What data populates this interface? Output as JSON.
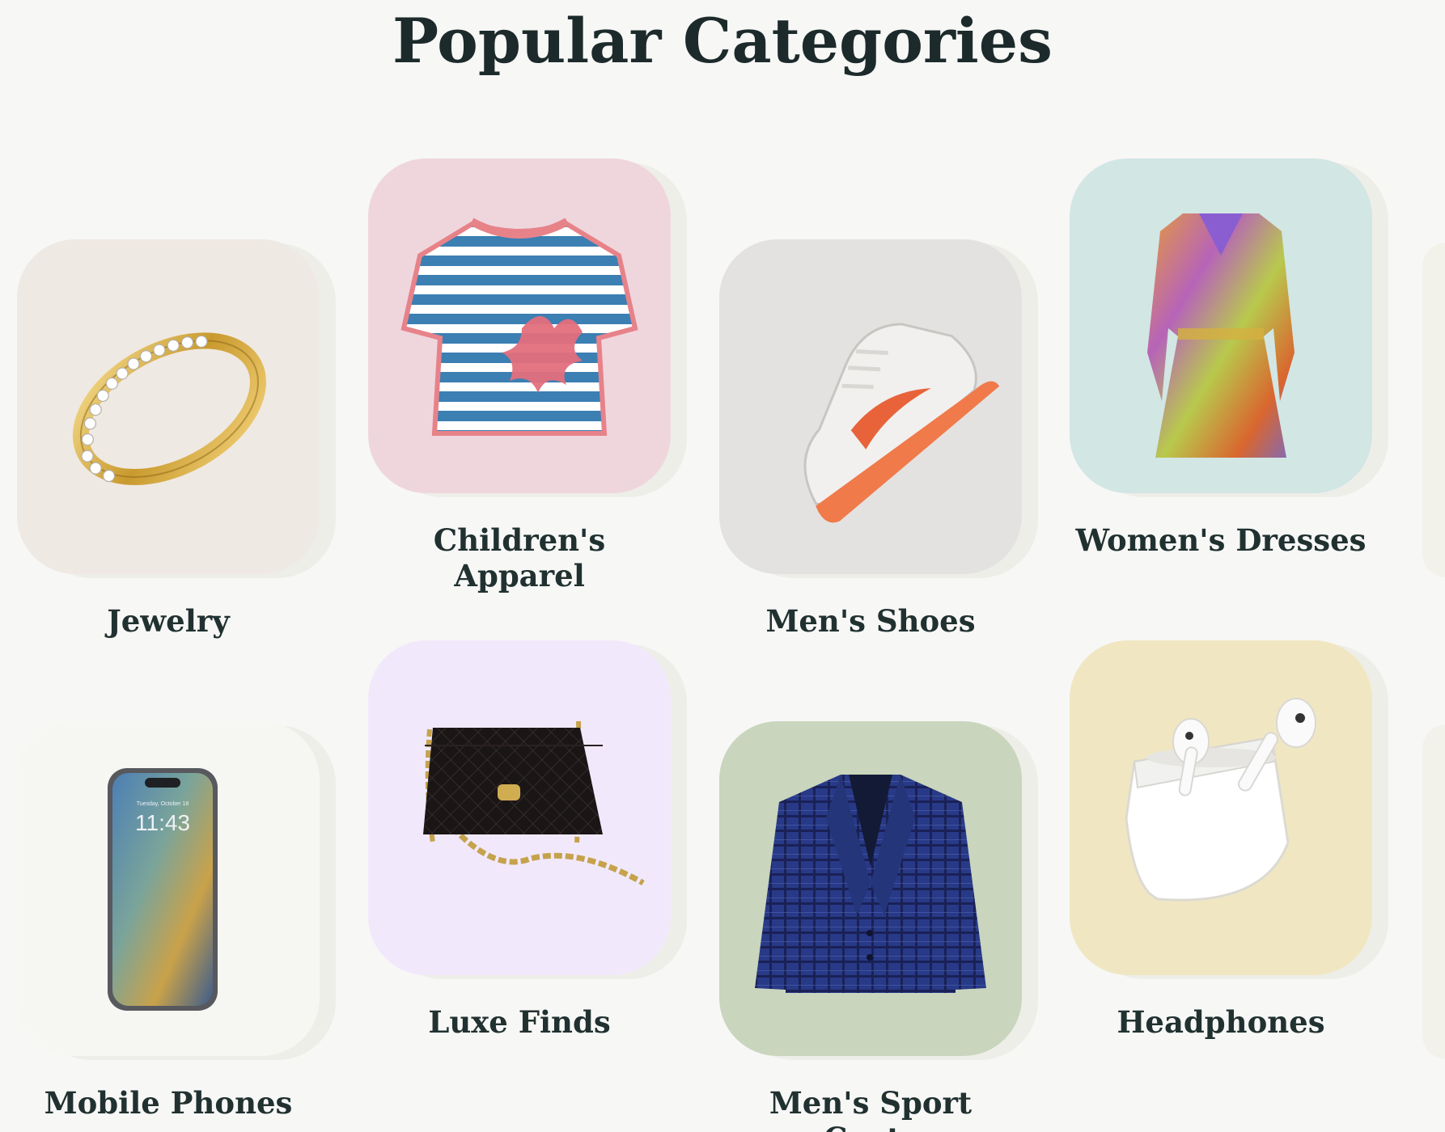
{
  "page": {
    "title": "Popular Categories"
  },
  "categories": [
    {
      "label": "Jewelry",
      "bg": "#efe9e3",
      "icon": "ring-image"
    },
    {
      "label": "Children's Apparel",
      "bg": "#efd6dd",
      "icon": "striped-shirt-image"
    },
    {
      "label": "Men's Shoes",
      "bg": "#e3e2e0",
      "icon": "sneaker-image"
    },
    {
      "label": "Women's Dresses",
      "bg": "#d2e6e4",
      "icon": "dress-image"
    },
    {
      "label": "Mobile Phones",
      "bg": "#f6f6f2",
      "icon": "smartphone-image"
    },
    {
      "label": "Luxe Finds",
      "bg": "#f1e9fb",
      "icon": "handbag-image"
    },
    {
      "label": "Men's Sport Coats",
      "bg": "#c9d5bd",
      "icon": "blazer-image"
    },
    {
      "label": "Headphones",
      "bg": "#f0e7c2",
      "icon": "earbuds-image"
    }
  ],
  "phone_screen": {
    "date": "Tuesday, October 18",
    "time": "11:43"
  }
}
